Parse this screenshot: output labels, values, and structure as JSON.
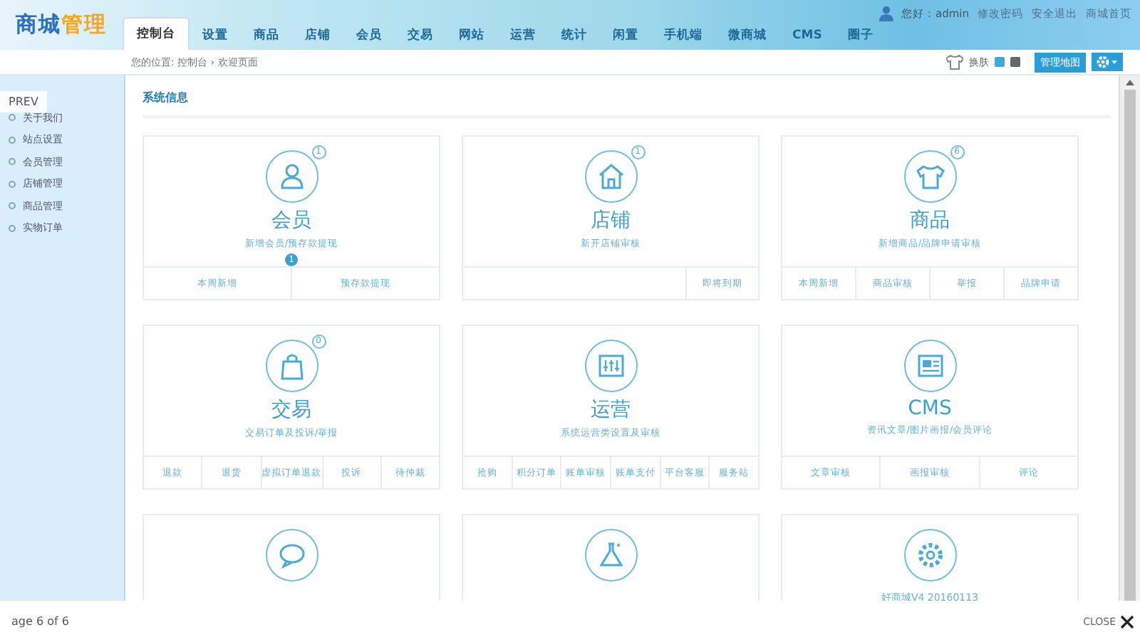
{
  "logo": {
    "part_1": "商城",
    "part_2": "管理"
  },
  "nav_tabs": [
    {
      "label": "控制台",
      "selected": true
    },
    {
      "label": "设置",
      "selected": false
    },
    {
      "label": "商品",
      "selected": false
    },
    {
      "label": "店铺",
      "selected": false
    },
    {
      "label": "会员",
      "selected": false
    },
    {
      "label": "交易",
      "selected": false
    },
    {
      "label": "网站",
      "selected": false
    },
    {
      "label": "运营",
      "selected": false
    },
    {
      "label": "统计",
      "selected": false
    },
    {
      "label": "闲置",
      "selected": false
    },
    {
      "label": "手机端",
      "selected": false
    },
    {
      "label": "微商城",
      "selected": false
    },
    {
      "label": "CMS",
      "selected": false
    },
    {
      "label": "圈子",
      "selected": false
    }
  ],
  "user_bar": {
    "greeting": "您好：admin",
    "links": [
      "修改密码",
      "安全退出",
      "商城首页"
    ]
  },
  "breadcrumb": {
    "label": "您的位置:",
    "path": [
      "控制台",
      "欢迎页面"
    ],
    "separator": "›"
  },
  "toolbar": {
    "skin_label": "换肤",
    "skins": [
      {
        "color": "#3fa9d8"
      },
      {
        "color": "#666666"
      }
    ],
    "map_button": "管理地图"
  },
  "sidebar": {
    "items": [
      "关于我们",
      "站点设置",
      "会员管理",
      "店铺管理",
      "商品管理",
      "实物订单"
    ]
  },
  "section_title": "系统信息",
  "cards": [
    {
      "kind": "module",
      "badge": "1",
      "title": "会员",
      "description": "新增会员/预存款提现",
      "links": [
        {
          "label": "本周新增"
        },
        {
          "label": "预存款提现",
          "badge": "1"
        }
      ]
    },
    {
      "kind": "module",
      "badge": "1",
      "title": "店铺",
      "description": "新开店铺审核",
      "links": [
        {
          "label": "即将到期"
        }
      ]
    },
    {
      "kind": "module",
      "badge": "6",
      "title": "商品",
      "description": "新增商品/品牌申请审核",
      "links": [
        {
          "label": "本周新增"
        },
        {
          "label": "商品审核"
        },
        {
          "label": "举报"
        },
        {
          "label": "品牌申请"
        }
      ]
    },
    {
      "kind": "module",
      "badge": "0",
      "title": "交易",
      "description": "交易订单及投诉/举报",
      "links": [
        {
          "label": "退款"
        },
        {
          "label": "退货"
        },
        {
          "label": "虚拟订单退款"
        },
        {
          "label": "投诉"
        },
        {
          "label": "待仲裁"
        }
      ]
    },
    {
      "kind": "module",
      "title": "运营",
      "description": "系统运营类设置及审核",
      "links": [
        {
          "label": "抢购"
        },
        {
          "label": "积分订单"
        },
        {
          "label": "账单审核"
        },
        {
          "label": "账单支付"
        },
        {
          "label": "平台客服"
        },
        {
          "label": "服务站"
        }
      ]
    },
    {
      "kind": "module",
      "title": "CMS",
      "description": "资讯文章/图片画报/会员评论",
      "links": [
        {
          "label": "文章审核"
        },
        {
          "label": "画报审核"
        },
        {
          "label": "评论"
        }
      ]
    },
    {
      "kind": "plain"
    },
    {
      "kind": "plain"
    },
    {
      "kind": "info",
      "description": "好商城V4   20160113"
    }
  ],
  "lightbox": {
    "prev": "PREV",
    "counter": "age 6 of 6",
    "close": "CLOSE"
  }
}
